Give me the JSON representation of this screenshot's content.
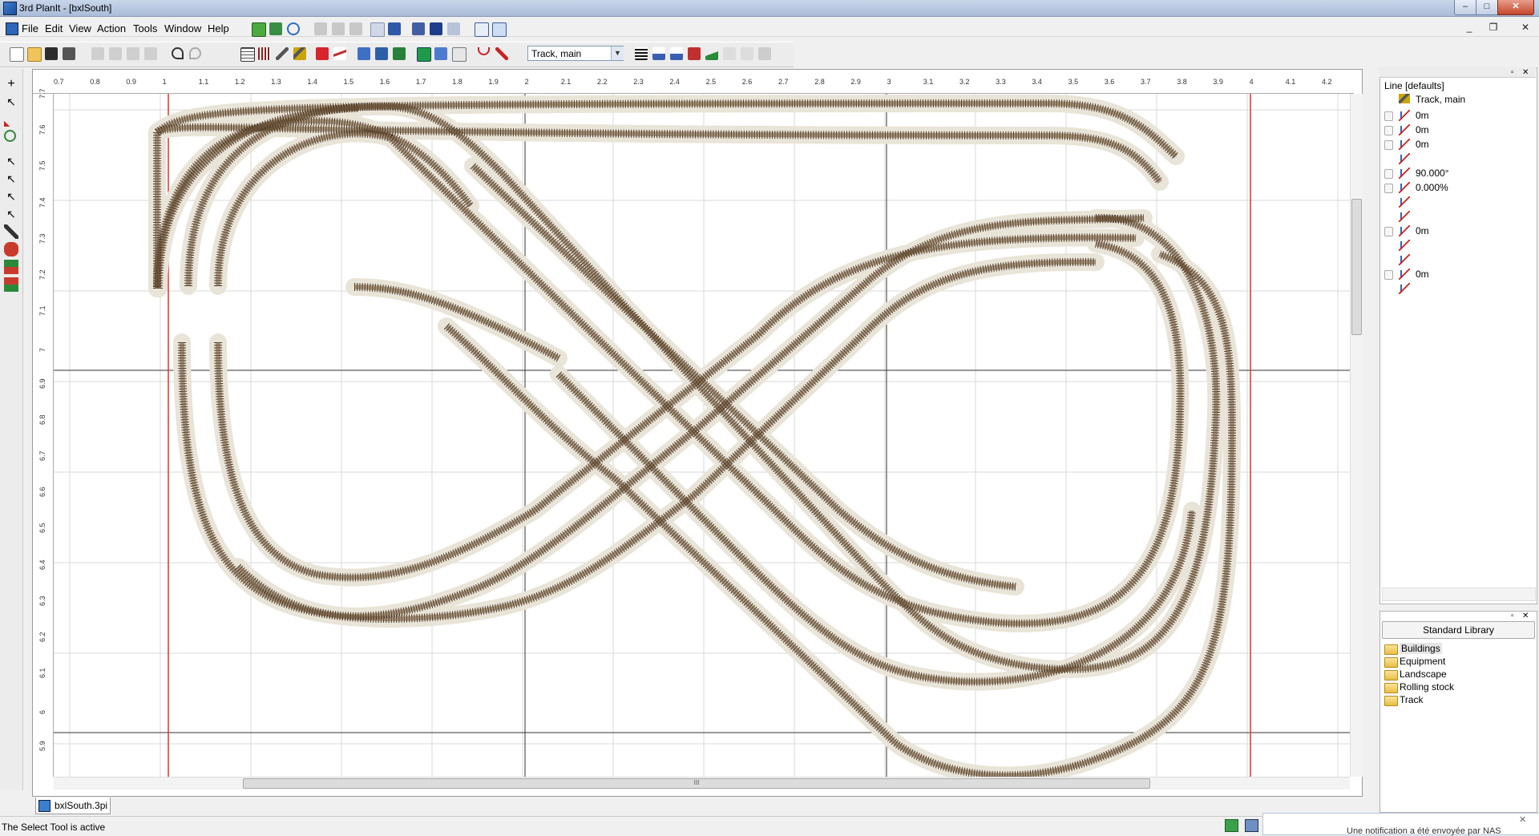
{
  "window": {
    "title": "3rd PlanIt - [bxlSouth]",
    "min_label": "–",
    "max_label": "□",
    "close_label": "✕"
  },
  "menu": {
    "items": [
      "File",
      "Edit",
      "View",
      "Action",
      "Tools",
      "Window",
      "Help"
    ],
    "mdi_min": "_",
    "mdi_restore": "❐",
    "mdi_close": "✕"
  },
  "toolbar": {
    "layer_select_value": "Track, main"
  },
  "rulers": {
    "top_ticks": [
      "0.7",
      "0.8",
      "0.9",
      "1",
      "1.1",
      "1.2",
      "1.3",
      "1.4",
      "1.5",
      "1.6",
      "1.7",
      "1.8",
      "1.9",
      "2",
      "2.1",
      "2.2",
      "2.3",
      "2.4",
      "2.5",
      "2.6",
      "2.7",
      "2.8",
      "2.9",
      "3",
      "3.1",
      "3.2",
      "3.3",
      "3.4",
      "3.5",
      "3.6",
      "3.7",
      "3.8",
      "3.9",
      "4",
      "4.1",
      "4.2"
    ],
    "left_ticks": [
      "7.7",
      "7.6",
      "7.5",
      "7.4",
      "7.3",
      "7.2",
      "7.1",
      "7",
      "6.9",
      "6.8",
      "6.7",
      "6.6",
      "6.5",
      "6.4",
      "6.3",
      "6.2",
      "6.1",
      "6",
      "5.9"
    ]
  },
  "scroll": {
    "hthumb_grip": "III"
  },
  "document_tab": {
    "label": "bxlSouth.3pi"
  },
  "properties": {
    "title": "Line [defaults]",
    "layer": "Track, main",
    "rows": [
      {
        "icon": "length-icon",
        "value": "0m"
      },
      {
        "icon": "dx-icon",
        "value": "0m"
      },
      {
        "icon": "dy-icon",
        "value": "0m"
      },
      {
        "icon": "rotate-icon",
        "value": ""
      },
      {
        "icon": "angle-icon",
        "value": "90.000°"
      },
      {
        "icon": "grade-icon",
        "value": "0.000%"
      },
      {
        "icon": "x-axis-icon",
        "value": ""
      },
      {
        "icon": "y-axis-icon",
        "value": ""
      },
      {
        "icon": "z-start-icon",
        "value": "0m"
      },
      {
        "icon": "x-end-icon",
        "value": ""
      },
      {
        "icon": "y-end-icon",
        "value": ""
      },
      {
        "icon": "z-end-icon",
        "value": "0m"
      },
      {
        "icon": "ramp-icon",
        "value": ""
      }
    ]
  },
  "library": {
    "header": "Standard Library",
    "items": [
      "Buildings",
      "Equipment",
      "Landscape",
      "Rolling stock",
      "Track"
    ]
  },
  "status": {
    "text": "The Select Tool is active"
  },
  "notification": {
    "text": "Une notification a été envoyée par NAS"
  },
  "colors": {
    "track_bed": "#e9e4d8",
    "track_rail": "#6b5236",
    "track_ties": "#4a3421",
    "grid": "#d9d9d9",
    "axis": "#333333",
    "guide_red": "#e0332a"
  }
}
